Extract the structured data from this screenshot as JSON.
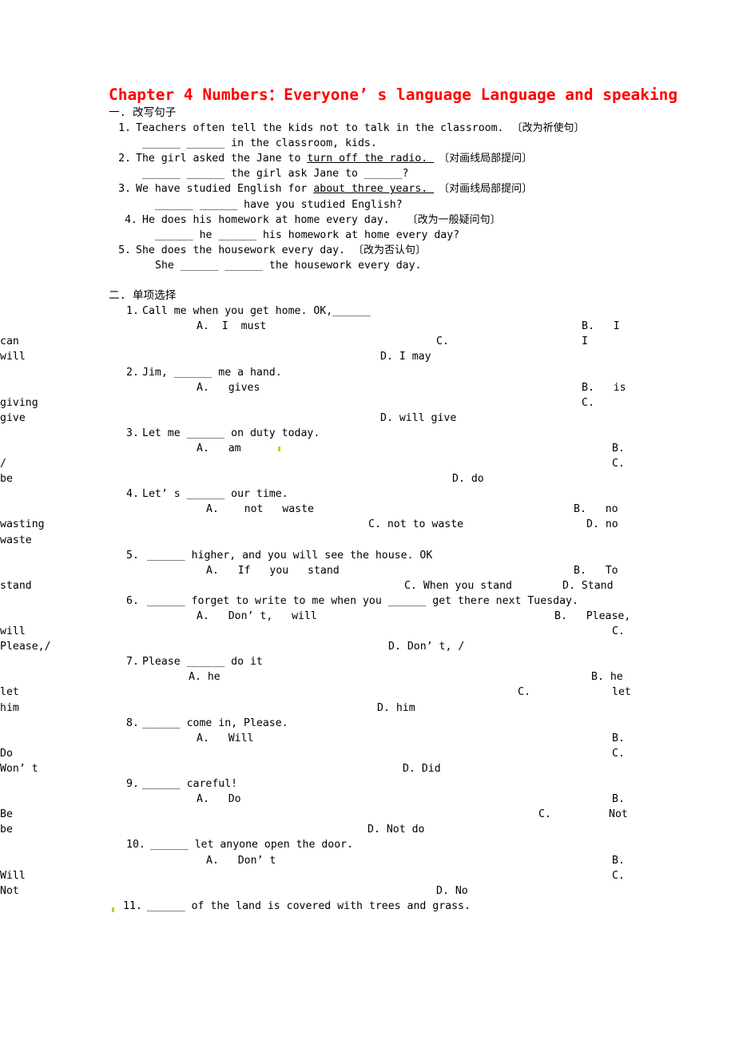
{
  "document": {
    "title": "Chapter 4 Numbers：Everyone’ s language Language and speaking",
    "title_color": "#ff0000"
  },
  "section_one": {
    "heading": "一. 改写句子",
    "items": [
      {
        "number": "1.",
        "prompt": "Teachers often tell the kids not to talk in the classroom.",
        "note": "〔改为祈使句〕",
        "answer_line": "______ ______ in the classroom, kids."
      },
      {
        "number": "2.",
        "prompt_pre": "The girl asked the Jane to ",
        "prompt_underlined": "turn off the radio. ",
        "note": "〔对画线局部提问〕",
        "answer_line": "______ ______ the girl ask Jane to ______?"
      },
      {
        "number": "3.",
        "prompt_pre": "We have studied English for ",
        "prompt_underlined": "about three years. ",
        "note": "〔对画线局部提问〕",
        "answer_line": "______ ______ have you studied English?"
      },
      {
        "number": "4.",
        "prompt": "He does his homework at home every day.",
        "note": "〔改为一般疑问句〕",
        "answer_line": "______ he ______ his homework at home every day?"
      },
      {
        "number": "5.",
        "prompt": "She does the housework every day.",
        "note": "〔改为否认句〕",
        "answer_line": "She ______ ______ the housework every day."
      }
    ]
  },
  "section_two": {
    "heading": "二. 单项选择",
    "questions": [
      {
        "number": "1.",
        "stem": "Call me when you get home. OK,______",
        "opt_a": "A.  I  must",
        "opt_b": "B.   I",
        "opt_b_cont": "can",
        "opt_c": "C.",
        "opt_c_cont": "I",
        "opt_c_tail": "will",
        "opt_d": "D. I may"
      },
      {
        "number": "2.",
        "stem": "Jim, ______ me a hand.",
        "opt_a": "A.   gives",
        "opt_b": "B.   is",
        "opt_b_cont": "giving",
        "opt_c": "C.",
        "opt_c_cont": "give",
        "opt_d": "D. will give"
      },
      {
        "number": "3.",
        "stem": "Let me ______ on duty today.",
        "opt_a": "A.   am",
        "opt_b": "B.",
        "opt_b_cont": "/",
        "opt_c": "C.",
        "opt_c_cont": "be",
        "opt_d": "D. do"
      },
      {
        "number": "4.",
        "stem": "Let’ s ______ our time.",
        "opt_a": "A.    not   waste",
        "opt_b": "B.   no",
        "opt_b_cont": "wasting",
        "opt_c": "C. not to waste",
        "opt_d": "D. no",
        "opt_d_cont": "waste"
      },
      {
        "number": "5.",
        "stem": "______ higher, and you will see the house. OK",
        "opt_a": "A.   If   you   stand",
        "opt_b": "B.   To",
        "opt_b_cont": "stand",
        "opt_c": "C. When you stand",
        "opt_d": "D. Stand"
      },
      {
        "number": "6.",
        "stem": "______ forget to write to me when you ______ get there next Tuesday.",
        "opt_a": "A.   Don’ t,   will",
        "opt_b": "B.   Please,",
        "opt_b_cont": "will",
        "opt_c": "C.",
        "opt_c_cont": "Please,/",
        "opt_d": "D. Don’ t, /"
      },
      {
        "number": "7.",
        "stem": "Please ______ do it",
        "opt_a": "A. he",
        "opt_b": "B. he",
        "opt_b_cont": "let",
        "opt_c": "C.",
        "opt_c_tail": "let",
        "opt_c_cont": "him",
        "opt_d": "D. him"
      },
      {
        "number": "8.",
        "stem": "______ come in, Please.",
        "opt_a": "A.   Will",
        "opt_b": "B.",
        "opt_b_cont": "Do",
        "opt_c": "C.",
        "opt_c_cont": "Won’ t",
        "opt_d": "D. Did"
      },
      {
        "number": "9.",
        "stem": "______ careful!",
        "opt_a": "A.   Do",
        "opt_b": "B.",
        "opt_b_cont": "Be",
        "opt_c": "C.",
        "opt_c_tail": "Not",
        "opt_c_cont": "be",
        "opt_d": "D. Not do"
      },
      {
        "number": "10.",
        "stem": "______ let anyone open the door.",
        "opt_a": "A.   Don’ t",
        "opt_b": "B.",
        "opt_b_cont": "Will",
        "opt_c": "C.",
        "opt_c_cont": "Not",
        "opt_d": "D. No"
      },
      {
        "number": "11.",
        "stem": "______ of the land is covered with trees and grass."
      }
    ]
  }
}
